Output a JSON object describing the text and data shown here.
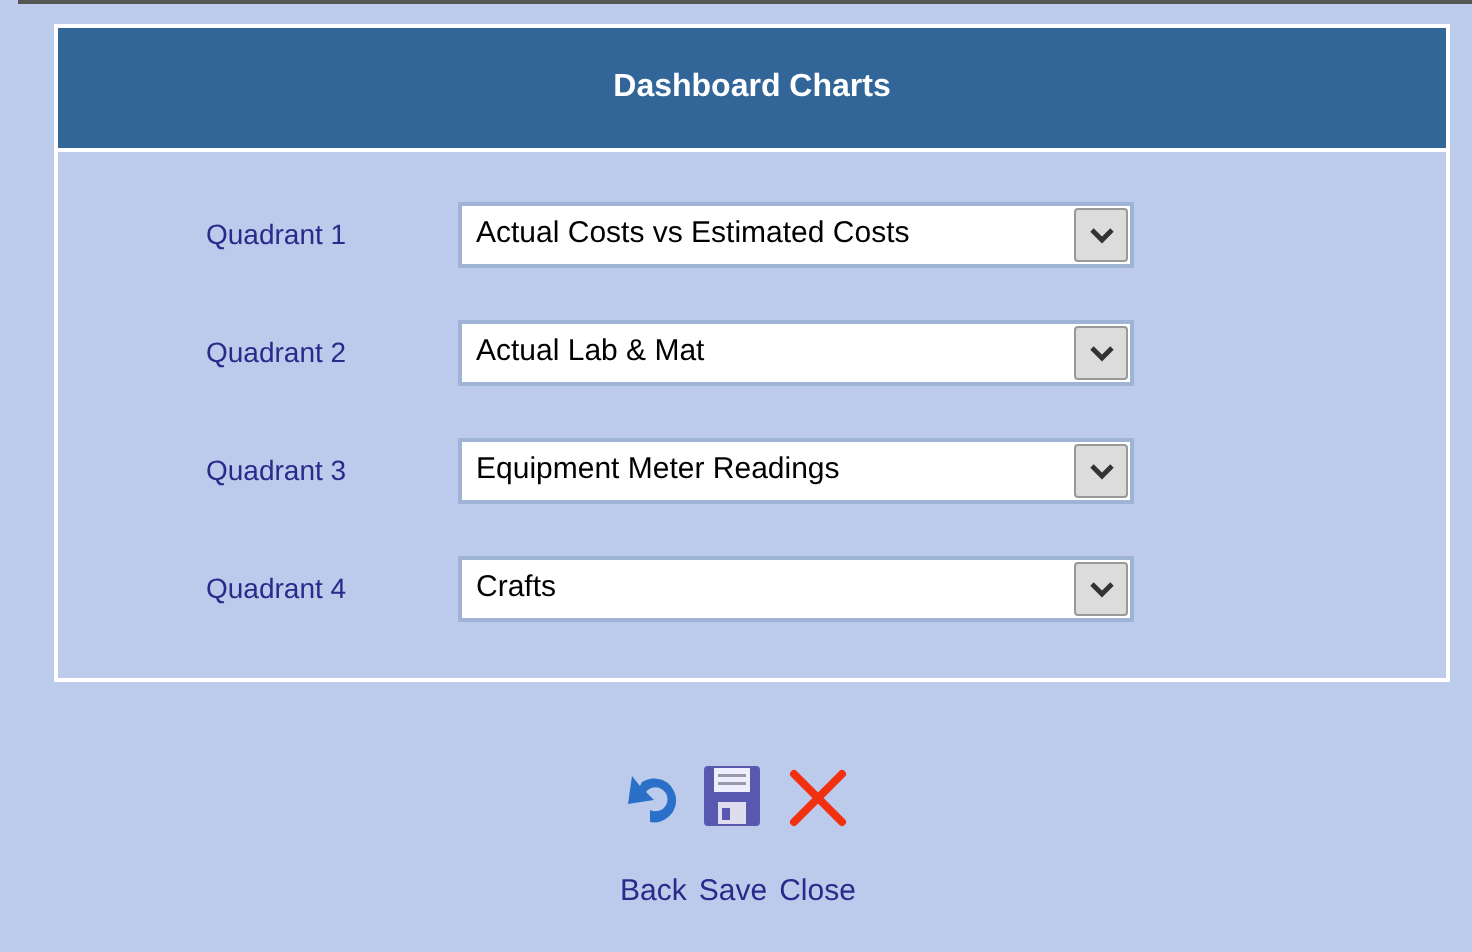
{
  "dialog": {
    "title": "Dashboard Charts"
  },
  "fields": [
    {
      "label": "Quadrant 1",
      "value": "Actual Costs vs Estimated Costs"
    },
    {
      "label": "Quadrant 2",
      "value": "Actual Lab & Mat"
    },
    {
      "label": "Quadrant 3",
      "value": "Equipment Meter Readings"
    },
    {
      "label": "Quadrant 4",
      "value": "Crafts"
    }
  ],
  "actions": [
    {
      "kind": "back",
      "label": "Back"
    },
    {
      "kind": "save",
      "label": "Save"
    },
    {
      "kind": "close",
      "label": "Close"
    }
  ]
}
